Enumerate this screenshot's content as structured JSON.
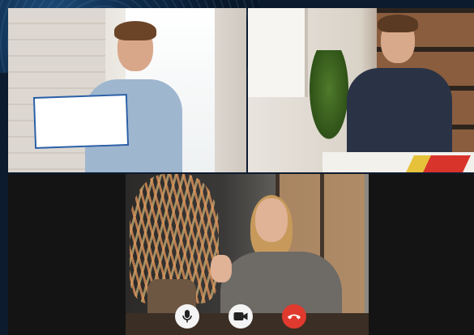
{
  "call": {
    "participants": [
      {
        "tile": "top-left"
      },
      {
        "tile": "top-right"
      },
      {
        "tile": "bottom"
      }
    ]
  },
  "controls": [
    {
      "icon": "microphone-icon",
      "action": "mute"
    },
    {
      "icon": "video-camera-icon",
      "action": "toggle-video"
    },
    {
      "icon": "hang-up-icon",
      "action": "end-call",
      "color": "#e03a2e"
    }
  ],
  "colors": {
    "control_background": "#f4f4f4",
    "end_call": "#e03a2e",
    "frame_background": "#0d1b2f"
  }
}
